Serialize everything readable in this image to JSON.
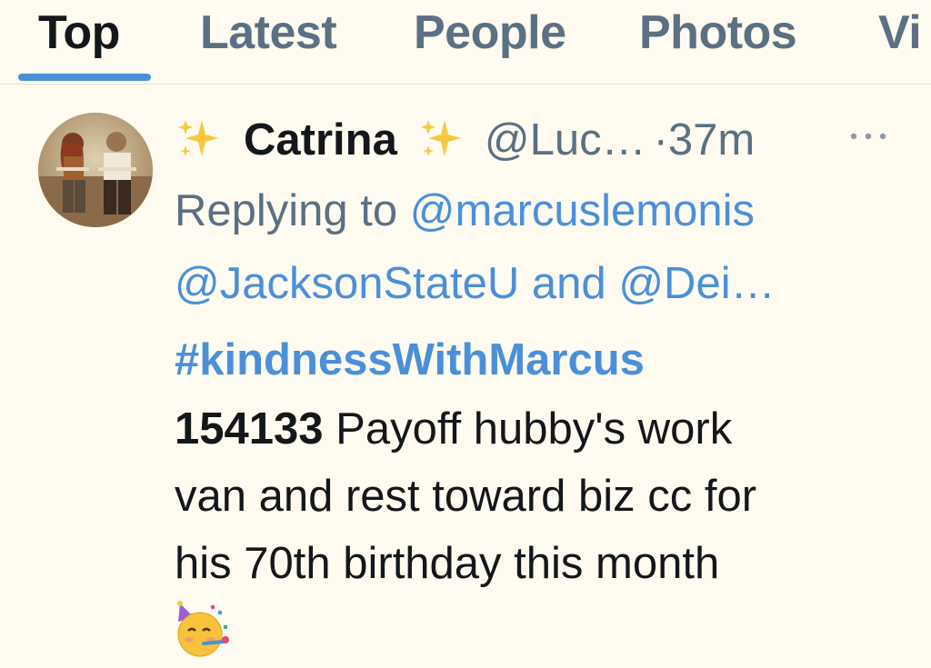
{
  "tabs": [
    {
      "label": "Top",
      "active": true
    },
    {
      "label": "Latest",
      "active": false
    },
    {
      "label": "People",
      "active": false
    },
    {
      "label": "Photos",
      "active": false
    },
    {
      "label": "Vi",
      "active": false
    }
  ],
  "colors": {
    "accent": "#4a90d9",
    "text": "#14171a",
    "muted": "#5b7083",
    "background": "#fffbf0"
  },
  "tweet": {
    "display_name": "Catrina",
    "handle": "@Luc…",
    "separator": "·",
    "time": "37m",
    "reply_prefix": "Replying to",
    "reply_mention_1": "@marcuslemonis",
    "reply_mention_2": "@JacksonStateU",
    "reply_and": "and",
    "reply_mention_3": "@Dei…",
    "hashtag": "#kindnessWithMarcus",
    "number": "154133",
    "text_line1": "Payoff hubby's work",
    "text_line2": "van and rest toward biz cc for",
    "text_line3": "his 70th birthday this month",
    "icons": {
      "name_decoration": "sparkles-icon",
      "more": "more-icon",
      "emoji": "partying-face-emoji"
    }
  }
}
